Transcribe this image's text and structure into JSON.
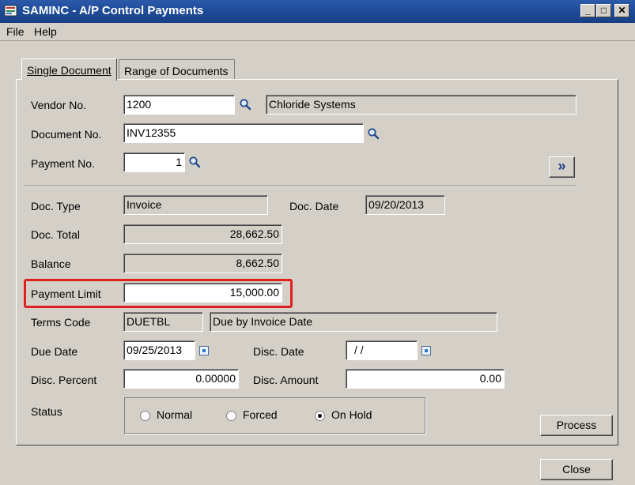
{
  "window": {
    "title": "SAMINC - A/P Control Payments",
    "minimize": "_",
    "maximize": "□",
    "close": "✕"
  },
  "menu": {
    "file": "File",
    "help": "Help"
  },
  "tabs": {
    "single": "Single Document",
    "range": "Range of Documents"
  },
  "form": {
    "vendor_label": "Vendor No.",
    "vendor_value": "1200",
    "vendor_name": "Chloride Systems",
    "document_label": "Document No.",
    "document_value": "INV12355",
    "payment_label": "Payment No.",
    "payment_value": "1",
    "next_button": "»",
    "doc_type_label": "Doc. Type",
    "doc_type_value": "Invoice",
    "doc_date_label": "Doc. Date",
    "doc_date_value": "09/20/2013",
    "doc_total_label": "Doc. Total",
    "doc_total_value": "28,662.50",
    "balance_label": "Balance",
    "balance_value": "8,662.50",
    "payment_limit_label": "Payment Limit",
    "payment_limit_value": "15,000.00",
    "terms_label": "Terms Code",
    "terms_code": "DUETBL",
    "terms_desc": "Due by Invoice Date",
    "due_date_label": "Due Date",
    "due_date_value": "09/25/2013",
    "disc_date_label": "Disc. Date",
    "disc_date_value": "/ /",
    "disc_percent_label": "Disc. Percent",
    "disc_percent_value": "0.00000",
    "disc_amount_label": "Disc. Amount",
    "disc_amount_value": "0.00",
    "status_label": "Status",
    "status_options": [
      "Normal",
      "Forced",
      "On Hold"
    ],
    "status_selected": "On Hold"
  },
  "buttons": {
    "process": "Process",
    "close": "Close"
  },
  "colors": {
    "titlebar": "#1f4c9a",
    "highlight": "#e0201e"
  }
}
